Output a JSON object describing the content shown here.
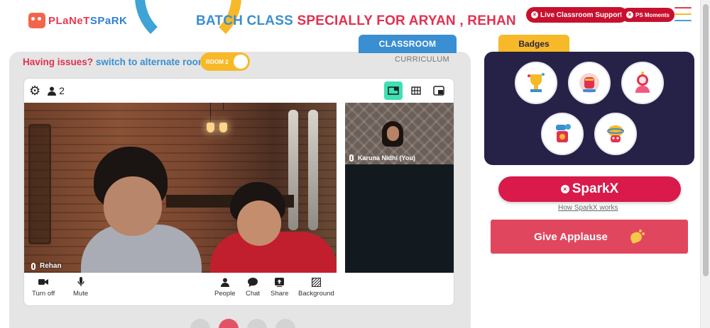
{
  "header": {
    "logo": {
      "part1": "PLaNeT",
      "part2": "SPaRK"
    },
    "title_prefix": "BATCH CLASS",
    "title_suffix": "SPECIALLY FOR ARYAN , REHAN",
    "support_button": "Live Classroom Support",
    "ps_button": "PS Moments"
  },
  "classroom": {
    "tab_active": "CLASSROOM",
    "tab_inactive": "CURRICULUM",
    "issues_question": "Having issues?",
    "issues_action": "switch to alternate room",
    "room_toggle": "ROOM 2",
    "participant_count": "2",
    "main_participant": "Rehan",
    "side_participant": "Karuna Nidhi (You)",
    "controls": {
      "turn_off": "Turn off",
      "mute": "Mute",
      "people": "People",
      "chat": "Chat",
      "share": "Share",
      "background": "Background"
    }
  },
  "badges": {
    "tab_label": "Badges",
    "items": [
      "badge-trophy",
      "badge-fist",
      "badge-astronaut",
      "badge-lightbulb",
      "badge-brain"
    ]
  },
  "sparkx": {
    "button_label": "SparkX",
    "link_label": "How SparkX works"
  },
  "applause": {
    "button_label": "Give Applause"
  },
  "colors": {
    "brand_red": "#e2314f",
    "brand_blue": "#3a8ed2",
    "brand_yellow": "#f7b928",
    "badge_panel": "#262247",
    "sparkx": "#d91a4a",
    "applause": "#e0475f",
    "active_view": "#3ee0b4"
  }
}
